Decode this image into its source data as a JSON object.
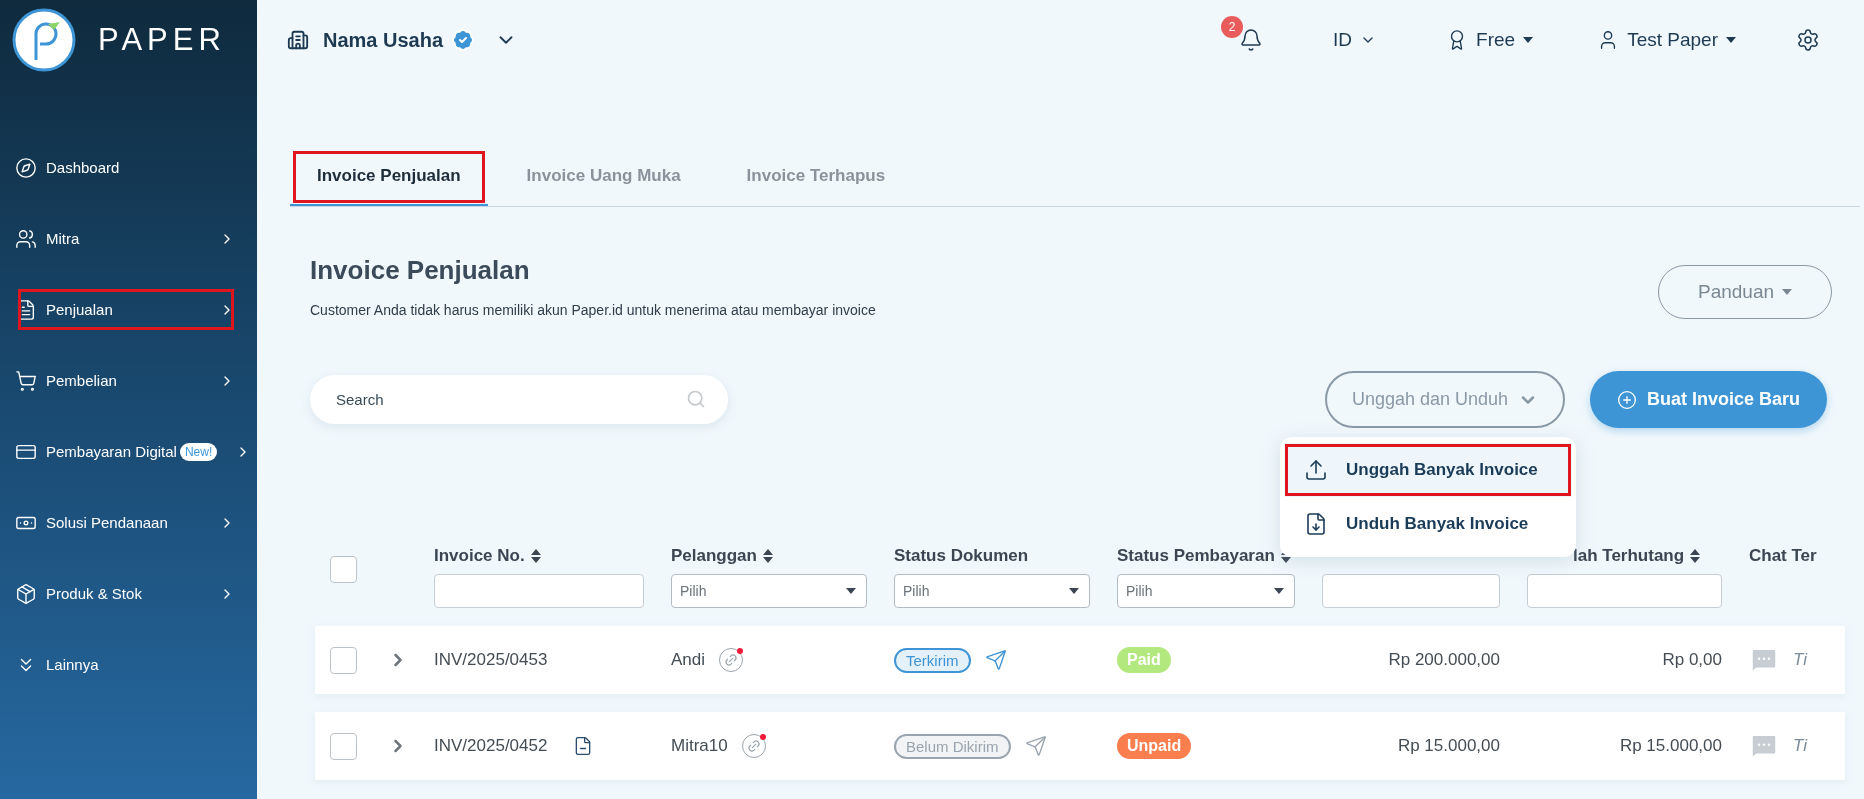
{
  "sidebar": {
    "logo": "PAPER",
    "items": [
      {
        "label": "Dashboard",
        "submenu": false,
        "highlighted": false
      },
      {
        "label": "Mitra",
        "submenu": true,
        "highlighted": false
      },
      {
        "label": "Penjualan",
        "submenu": true,
        "highlighted": true
      },
      {
        "label": "Pembelian",
        "submenu": true,
        "highlighted": false
      },
      {
        "label": "Pembayaran Digital",
        "badge": "New!",
        "submenu": true,
        "highlighted": false
      },
      {
        "label": "Solusi Pendanaan",
        "submenu": true,
        "highlighted": false
      },
      {
        "label": "Produk & Stok",
        "submenu": true,
        "highlighted": false
      },
      {
        "label": "Lainnya",
        "submenu": false,
        "highlighted": false
      }
    ]
  },
  "header": {
    "business_name": "Nama Usaha",
    "verified": true,
    "notifications": "2",
    "language": "ID",
    "plan": "Free",
    "user": "Test Paper"
  },
  "tabs": [
    {
      "label": "Invoice Penjualan",
      "selected": true,
      "highlighted": true
    },
    {
      "label": "Invoice Uang Muka",
      "selected": false,
      "highlighted": false
    },
    {
      "label": "Invoice Terhapus",
      "selected": false,
      "highlighted": false
    }
  ],
  "page": {
    "title": "Invoice Penjualan",
    "subtitle": "Customer Anda tidak harus memiliki akun Paper.id untuk menerima atau membayar invoice",
    "guide_button": "Panduan"
  },
  "search": {
    "placeholder": "Search"
  },
  "upload_button": "Unggah dan Unduh",
  "create_button": "Buat Invoice Baru",
  "menu": [
    {
      "label": "Unggah Banyak Invoice",
      "kind": "upload",
      "highlighted": true
    },
    {
      "label": "Unduh Banyak Invoice",
      "kind": "download",
      "highlighted": false
    }
  ],
  "table": {
    "select_all": {
      "checked": false
    },
    "columns": [
      {
        "label": "Invoice No.",
        "sortable": true,
        "kind": "text"
      },
      {
        "label": "Pelanggan",
        "sortable": true,
        "kind": "select",
        "placeholder": "Pilih"
      },
      {
        "label": "Status Dokumen",
        "sortable": false,
        "kind": "select",
        "placeholder": "Pilih"
      },
      {
        "label": "Status Pembayaran",
        "sortable": true,
        "kind": "select",
        "placeholder": "Pilih"
      },
      {
        "kind": "text"
      },
      {
        "label": "lah Terhutang",
        "sortable": true,
        "kind": "text"
      },
      {
        "label": "Chat Ter",
        "sortable": false,
        "kind": "plain"
      }
    ],
    "rows": [
      {
        "checked": false,
        "expanded": false,
        "invoice_no": "INV/2025/0453",
        "file_icon": false,
        "customer": "Andi",
        "doc_status": {
          "label": "Terkirim",
          "color": "#3d95d6"
        },
        "payment_status": {
          "label": "Paid",
          "color": "#b3e87e"
        },
        "amount": "Rp 200.000,00",
        "outstanding": "Rp 0,00",
        "chat": "Ti"
      },
      {
        "checked": false,
        "expanded": false,
        "invoice_no": "INV/2025/0452",
        "file_icon": true,
        "customer": "Mitra10",
        "doc_status": {
          "label": "Belum Dikirim",
          "color": "#9aa4ae"
        },
        "payment_status": {
          "label": "Unpaid",
          "color": "#fb7e4e"
        },
        "amount": "Rp 15.000,00",
        "outstanding": "Rp 15.000,00",
        "chat": "Ti"
      }
    ]
  }
}
